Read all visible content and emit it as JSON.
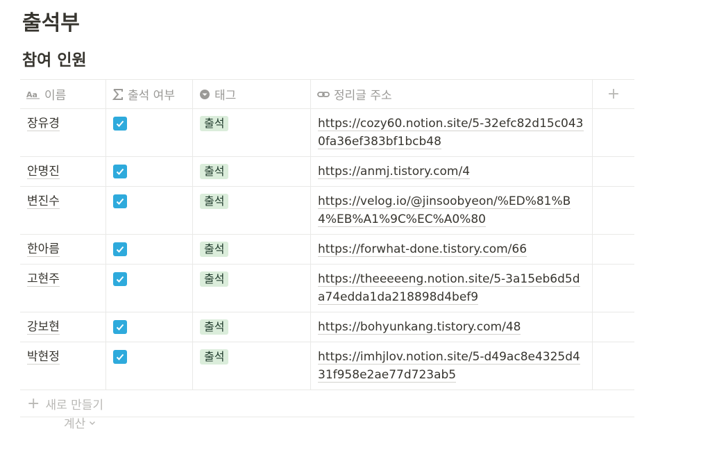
{
  "page": {
    "title": "출석부"
  },
  "section": {
    "title": "참여 인원"
  },
  "table": {
    "columns": [
      {
        "label": "이름",
        "icon": "text-type-icon"
      },
      {
        "label": "출석 여부",
        "icon": "sigma-icon"
      },
      {
        "label": "태그",
        "icon": "select-circle-icon"
      },
      {
        "label": "정리글 주소",
        "icon": "link-icon"
      }
    ],
    "add_column_label": "+",
    "rows": [
      {
        "name": "장유경",
        "checked": true,
        "tag": "출석",
        "url": "https://cozy60.notion.site/5-32efc82d15c0430fa36ef383bf1bcb48"
      },
      {
        "name": "안명진",
        "checked": true,
        "tag": "출석",
        "url": "https://anmj.tistory.com/4"
      },
      {
        "name": "변진수",
        "checked": true,
        "tag": "출석",
        "url": "https://velog.io/@jinsoobyeon/%ED%81%B4%EB%A1%9C%EC%A0%80"
      },
      {
        "name": "한아름",
        "checked": true,
        "tag": "출석",
        "url": "https://forwhat-done.tistory.com/66"
      },
      {
        "name": "고현주",
        "checked": true,
        "tag": "출석",
        "url": "https://theeeeeng.notion.site/5-3a15eb6d5da74edda1da218898d4bef9"
      },
      {
        "name": "강보현",
        "checked": true,
        "tag": "출석",
        "url": "https://bohyunkang.tistory.com/48"
      },
      {
        "name": "박현정",
        "checked": true,
        "tag": "출석",
        "url": "https://imhjlov.notion.site/5-d49ac8e4325d431f958e2ae77d723ab5"
      }
    ],
    "new_row_label": "새로 만들기",
    "calc_label": "계산"
  },
  "colors": {
    "checkbox": "#2eaadc",
    "tag_bg": "#dbeddb",
    "tag_text": "#1c3829",
    "muted": "#9b9a97"
  }
}
